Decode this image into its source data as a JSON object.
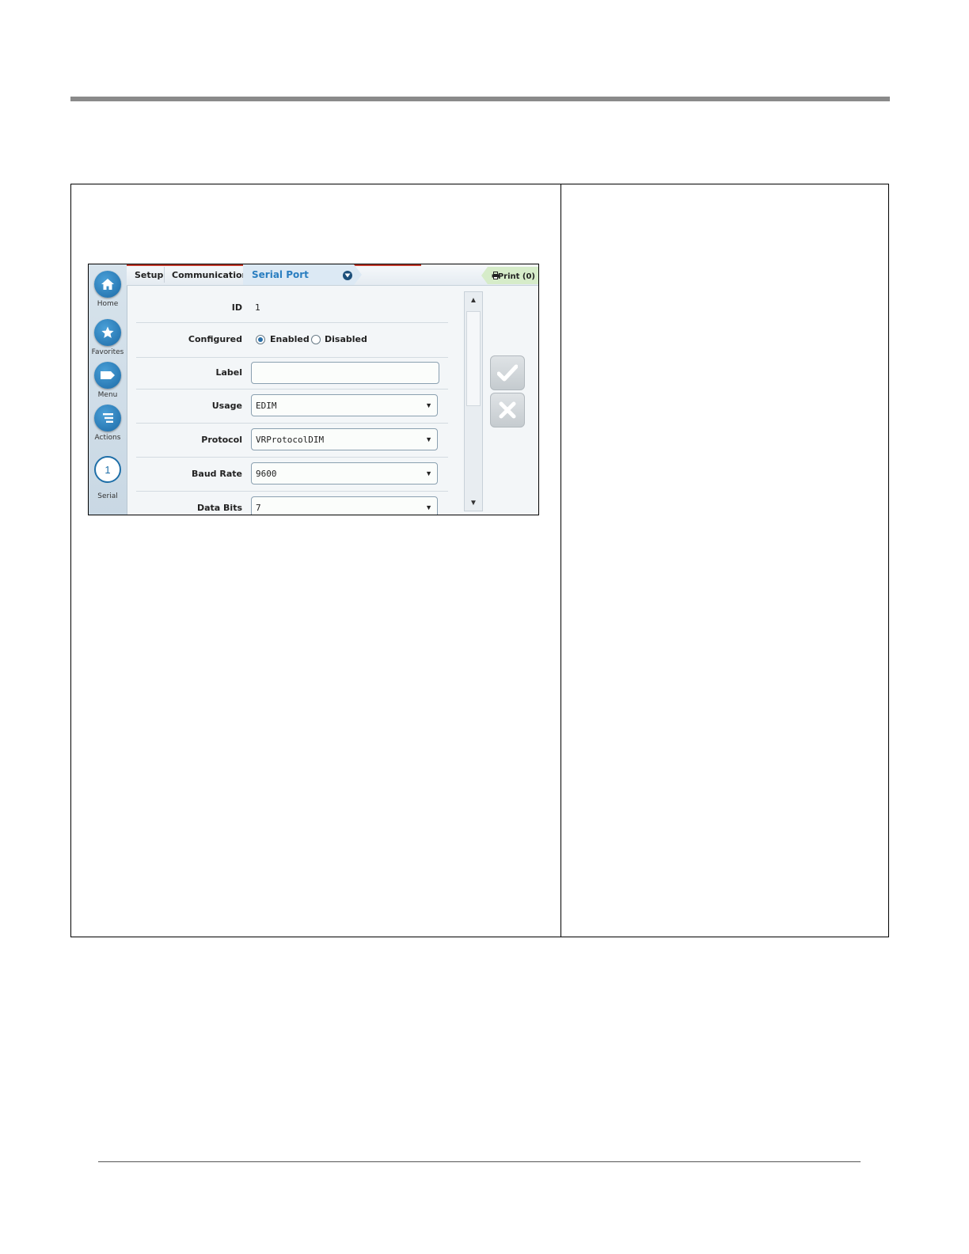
{
  "ui": {
    "sidebar": {
      "items": [
        {
          "label": "Home"
        },
        {
          "label": "Favorites"
        },
        {
          "label": "Menu"
        },
        {
          "label": "Actions"
        },
        {
          "label": "Serial",
          "badge": "1"
        }
      ]
    },
    "breadcrumb": {
      "items": [
        "Setup",
        "Communication"
      ],
      "current": "Serial Port"
    },
    "print_label": "Print (0)",
    "form": {
      "id": {
        "label": "ID",
        "value": "1"
      },
      "configured": {
        "label": "Configured",
        "options": [
          "Enabled",
          "Disabled"
        ],
        "selected": "Enabled"
      },
      "label_field": {
        "label": "Label",
        "value": ""
      },
      "usage": {
        "label": "Usage",
        "value": "EDIM"
      },
      "protocol": {
        "label": "Protocol",
        "value": "VRProtocolDIM"
      },
      "baud_rate": {
        "label": "Baud Rate",
        "value": "9600"
      },
      "data_bits": {
        "label": "Data Bits",
        "value": "7"
      }
    },
    "colors": {
      "accent_blue": "#2a7ec0",
      "sidebar_button": "#1c6aa6",
      "print_tab": "#d6ecc9",
      "top_accent": "#c0392b"
    }
  }
}
